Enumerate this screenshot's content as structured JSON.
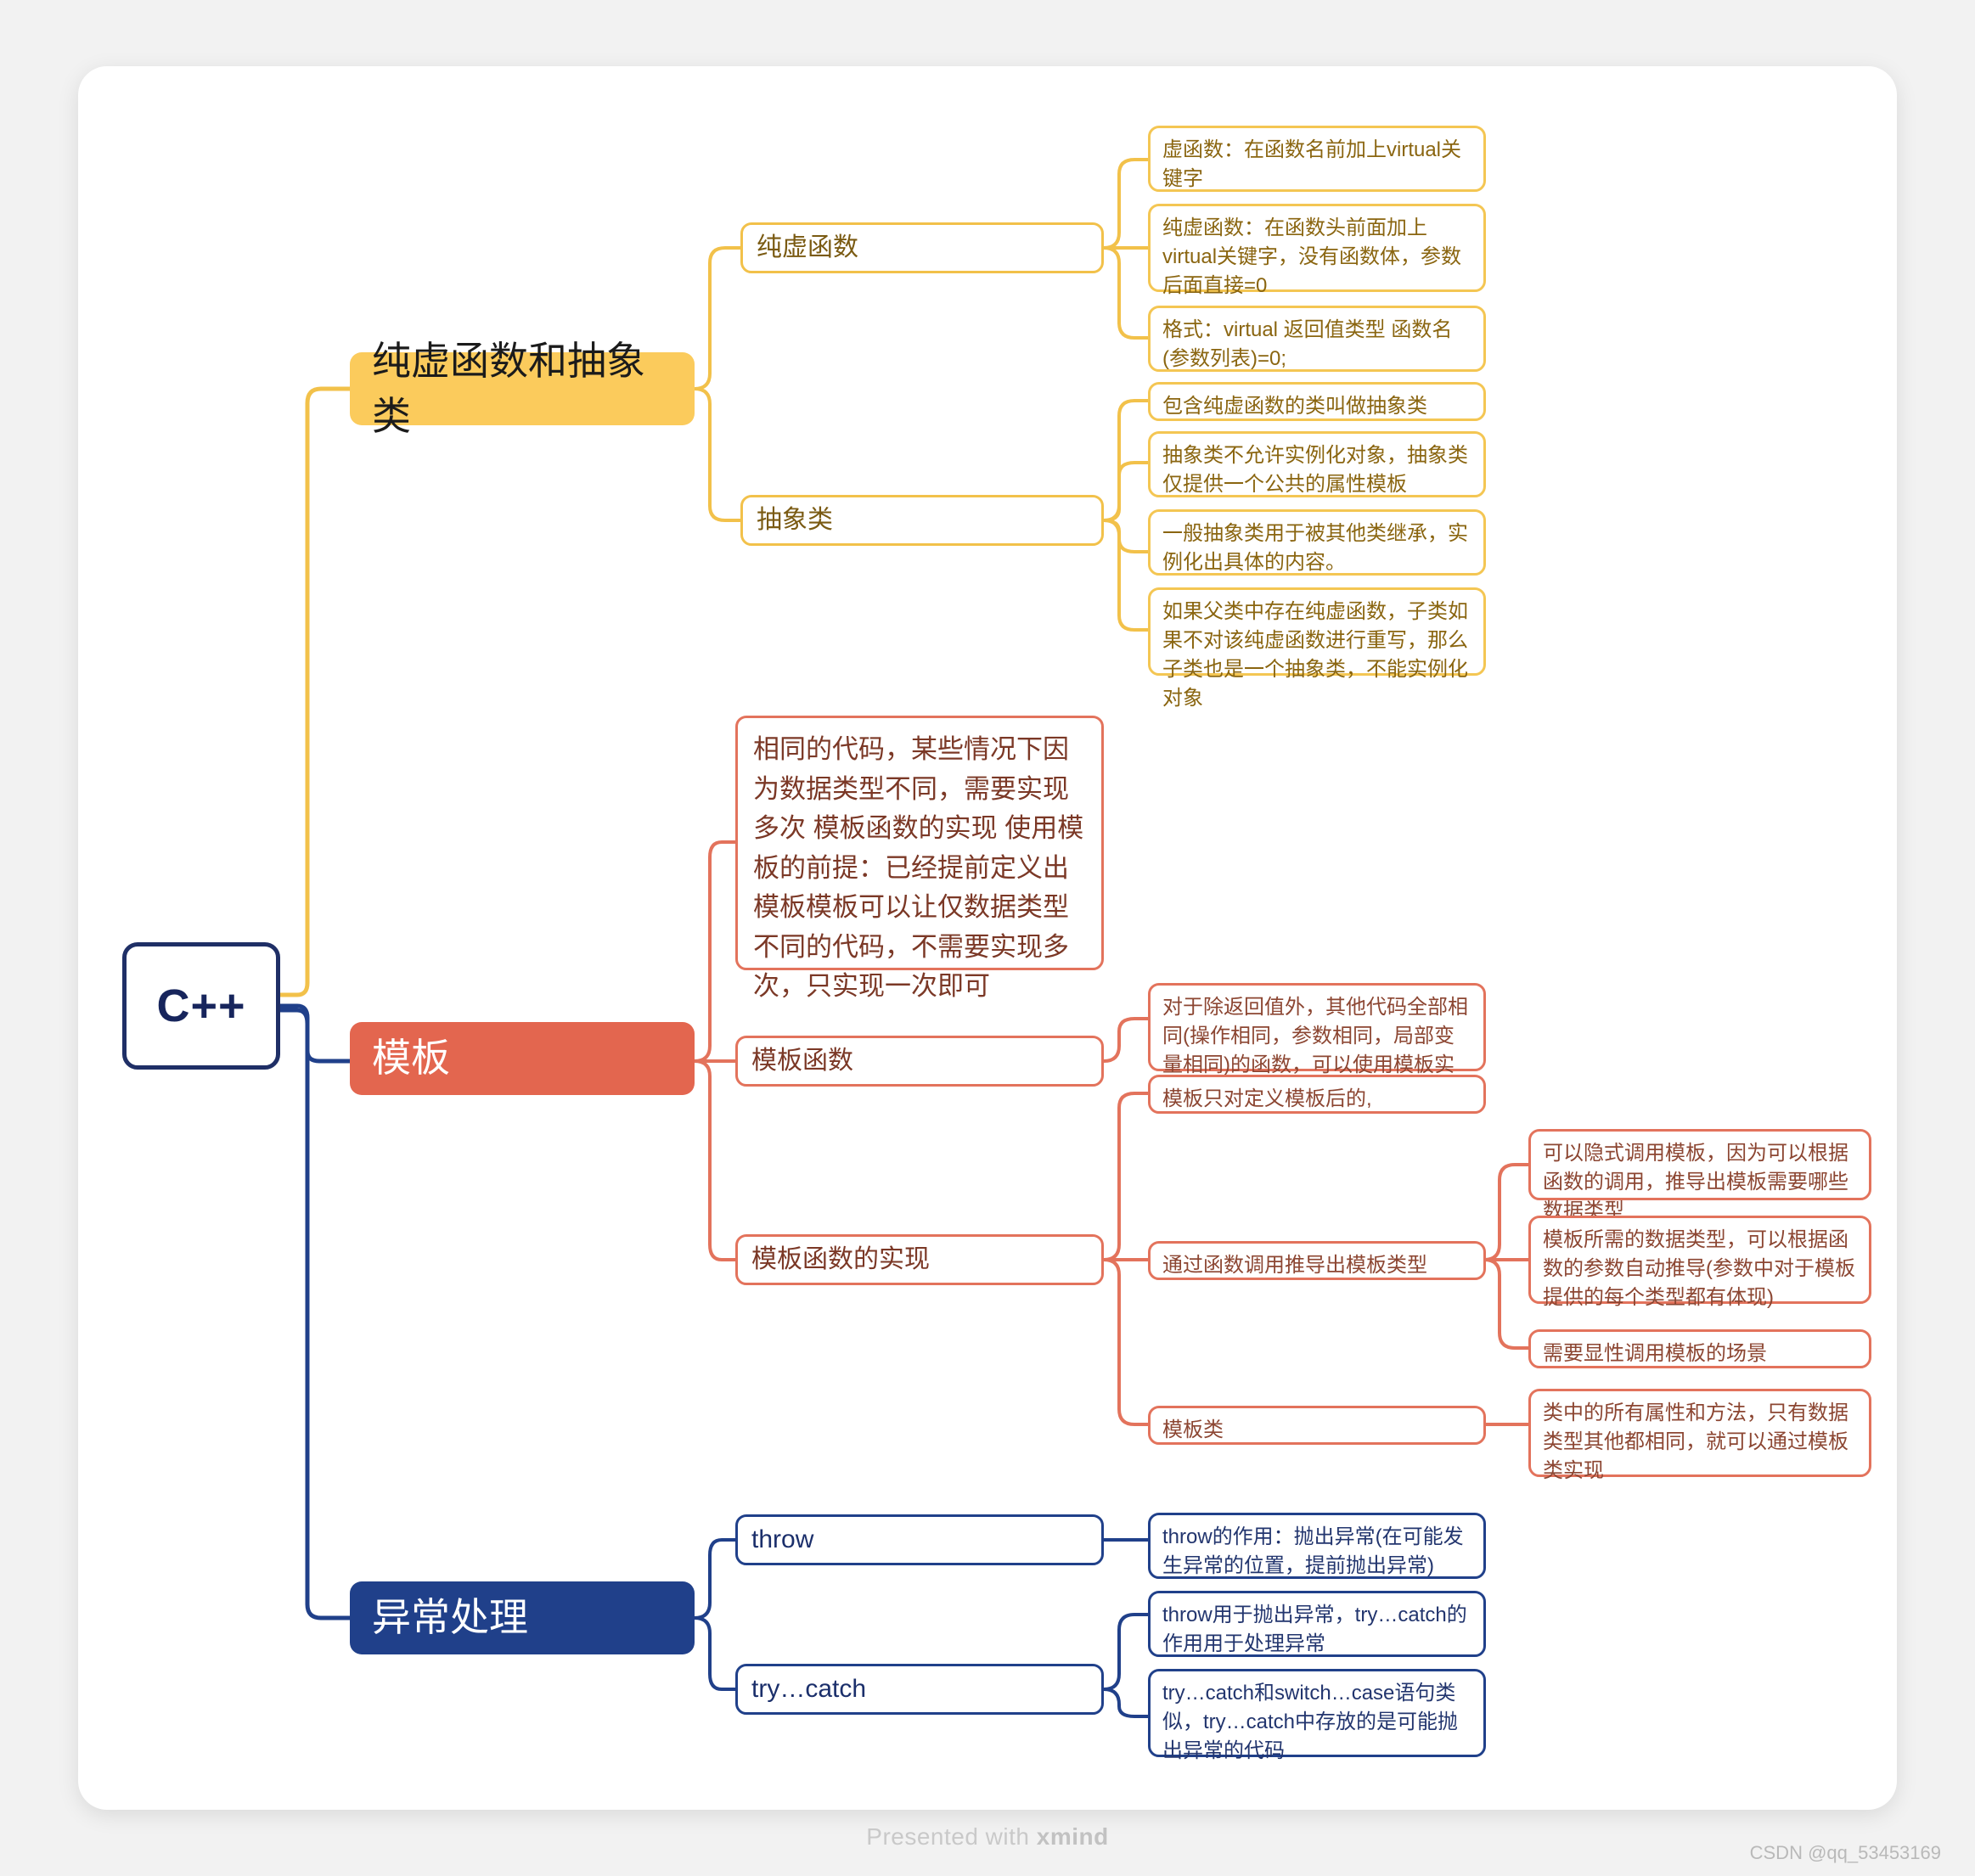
{
  "canvas": {
    "brand_prefix": "Presented with ",
    "brand_name": "xmind",
    "watermark": "CSDN @qq_53453169"
  },
  "colors": {
    "root_border": "#1f2f66",
    "root_text": "#17255c",
    "amber": "#fbcb5c",
    "amber_border": "#f2c14a",
    "amber_text": "#7a5a12",
    "coral": "#e3664f",
    "coral_border": "#e3735c",
    "coral_text": "#7b3826",
    "navy": "#20408a",
    "navy_text": "#1b2f6b",
    "page_bg": "#f2f2f2",
    "card_bg": "#ffffff"
  },
  "root": {
    "label": "C++"
  },
  "branches": [
    {
      "id": "pure-virtual",
      "topic": "纯虚函数和抽象类",
      "theme": "amber",
      "children": [
        {
          "label": "纯虚函数",
          "leaves": [
            "虚函数：在函数名前加上virtual关键字",
            "纯虚函数：在函数头前面加上virtual关键字，没有函数体，参数后面直接=0",
            "格式：virtual 返回值类型 函数名(参数列表)=0;"
          ]
        },
        {
          "label": "抽象类",
          "leaves": [
            "包含纯虚函数的类叫做抽象类",
            "抽象类不允许实例化对象，抽象类仅提供一个公共的属性模板",
            "一般抽象类用于被其他类继承，实例化出具体的内容。",
            "如果父类中存在纯虚函数，子类如果不对该纯虚函数进行重写，那么子类也是一个抽象类，不能实例化对象"
          ]
        }
      ]
    },
    {
      "id": "template",
      "topic": "模板",
      "theme": "coral",
      "children": [
        {
          "label": "相同的代码，某些情况下因为数据类型不同，需要实现多次 模板函数的实现 使用模板的前提：已经提前定义出模板模板可以让仅数据类型不同的代码，不需要实现多次，只实现一次即可",
          "is_paragraph": true,
          "leaves": []
        },
        {
          "label": "模板函数",
          "leaves": [
            "对于除返回值外，其他代码全部相同(操作相同，参数相同，局部变量相同)的函数，可以使用模板实现"
          ]
        },
        {
          "label": "模板函数的实现",
          "leaves": [
            "模板只对定义模板后的,",
            "通过函数调用推导出模板类型",
            "模板类"
          ]
        }
      ],
      "deep_groups": [
        {
          "parent": "通过函数调用推导出模板类型",
          "items": [
            "可以隐式调用模板，因为可以根据函数的调用，推导出模板需要哪些数据类型",
            "模板所需的数据类型，可以根据函数的参数自动推导(参数中对于模板提供的每个类型都有体现)",
            "需要显性调用模板的场景"
          ]
        },
        {
          "parent": "模板类",
          "items": [
            "类中的所有属性和方法，只有数据类型其他都相同，就可以通过模板类实现"
          ]
        }
      ]
    },
    {
      "id": "exception",
      "topic": "异常处理",
      "theme": "navy",
      "children": [
        {
          "label": "throw",
          "leaves": [
            "throw的作用：抛出异常(在可能发生异常的位置，提前抛出异常)"
          ]
        },
        {
          "label": "try…catch",
          "leaves": [
            "throw用于抛出异常，try…catch的作用用于处理异常",
            "try…catch和switch…case语句类似，try…catch中存放的是可能抛出异常的代码"
          ]
        }
      ]
    }
  ]
}
